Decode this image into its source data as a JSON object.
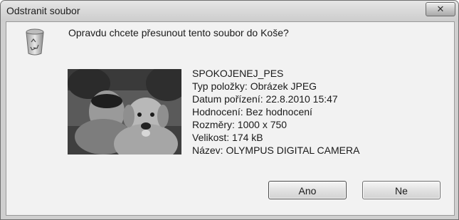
{
  "window": {
    "title": "Odstranit soubor",
    "close_glyph": "✕"
  },
  "dialog": {
    "icon": "recycle-bin-icon",
    "question": "Opravdu chcete přesunout tento soubor do Koše?",
    "thumbnail": "photo-thumbnail",
    "file": {
      "name": "SPOKOJENEJ_PES",
      "type": "Typ položky: Obrázek JPEG",
      "date_taken": "Datum pořízení: 22.8.2010 15:47",
      "rating": "Hodnocení: Bez hodnocení",
      "dimensions": "Rozměry: 1000 x 750",
      "size": "Velikost: 174 kB",
      "title": "Název: OLYMPUS DIGITAL CAMERA"
    }
  },
  "buttons": {
    "yes": "Ano",
    "no": "Ne"
  },
  "colors": {
    "titlebar": "#d6d6d6",
    "client": "#f2f2f2",
    "text": "#1a1a1a"
  }
}
